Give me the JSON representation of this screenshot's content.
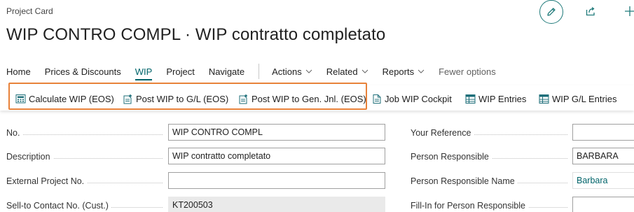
{
  "header": {
    "caption": "Project Card",
    "title": "WIP CONTRO COMPL · WIP contratto completato"
  },
  "menu": {
    "items": [
      "Home",
      "Prices & Discounts",
      "WIP",
      "Project",
      "Navigate"
    ],
    "active": "WIP",
    "dropdowns": [
      "Actions",
      "Related",
      "Reports"
    ],
    "fewer_options": "Fewer options"
  },
  "actions": [
    {
      "label": "Calculate WIP (EOS)",
      "icon": "calculate-icon"
    },
    {
      "label": "Post WIP to G/L (EOS)",
      "icon": "post-icon"
    },
    {
      "label": "Post WIP to Gen. Jnl. (EOS)",
      "icon": "post-icon"
    },
    {
      "label": "Job WIP Cockpit",
      "icon": "document-icon"
    },
    {
      "label": "WIP Entries",
      "icon": "entries-icon"
    },
    {
      "label": "WIP G/L Entries",
      "icon": "entries-icon"
    }
  ],
  "form": {
    "left": [
      {
        "label": "No.",
        "value": "WIP CONTRO COMPL"
      },
      {
        "label": "Description",
        "value": "WIP contratto completato"
      },
      {
        "label": "External Project No.",
        "value": ""
      },
      {
        "label": "Sell-to Contact No. (Cust.)",
        "value": "KT200503"
      }
    ],
    "right": [
      {
        "label": "Your Reference",
        "value": ""
      },
      {
        "label": "Person Responsible",
        "value": "BARBARA"
      },
      {
        "label": "Person Responsible Name",
        "value": "Barbara"
      },
      {
        "label": "Fill-In for Person Responsible",
        "value": ""
      }
    ]
  },
  "colors": {
    "accent": "#00646a",
    "highlight": "#e8823a"
  }
}
